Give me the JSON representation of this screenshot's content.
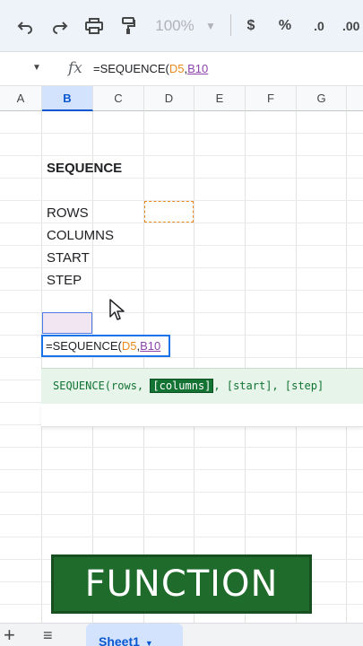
{
  "toolbar": {
    "undo_icon": "undo-icon",
    "redo_icon": "redo-icon",
    "print_icon": "print-icon",
    "paint_format_icon": "paint-format-icon",
    "zoom": "100%",
    "currency": "$",
    "percent": "%",
    "decrease_decimal": ".0",
    "increase_decimal": ".00"
  },
  "formula_bar": {
    "fx": "fx",
    "formula_prefix": "=SEQUENCE(",
    "ref1": "D5",
    "sep": ",",
    "ref2": "B10"
  },
  "columns": [
    "A",
    "B",
    "C",
    "D",
    "E",
    "F",
    "G"
  ],
  "selected_column": "B",
  "cells": {
    "title": "SEQUENCE",
    "rows": "ROWS",
    "columns_label": "COLUMNS",
    "start": "START",
    "step": "STEP"
  },
  "editor": {
    "prefix": "=SEQUENCE(",
    "ref1": "D5",
    "sep": ",",
    "ref2": "B10"
  },
  "hint": {
    "prefix": "SEQUENCE(rows, ",
    "active_arg": "[columns]",
    "rest": ", [start], [step]"
  },
  "banner": {
    "text": "FUNCTION"
  },
  "sheets": {
    "add": "+",
    "list": "≡",
    "active": "Sheet1"
  },
  "colors": {
    "toolbar_bg": "#eef2f9",
    "ref_orange": "#e8891d",
    "ref_purple": "#8e44ad",
    "hint_green": "#137333",
    "banner_green": "#1f6b2c",
    "selection_blue": "#1a73e8"
  }
}
